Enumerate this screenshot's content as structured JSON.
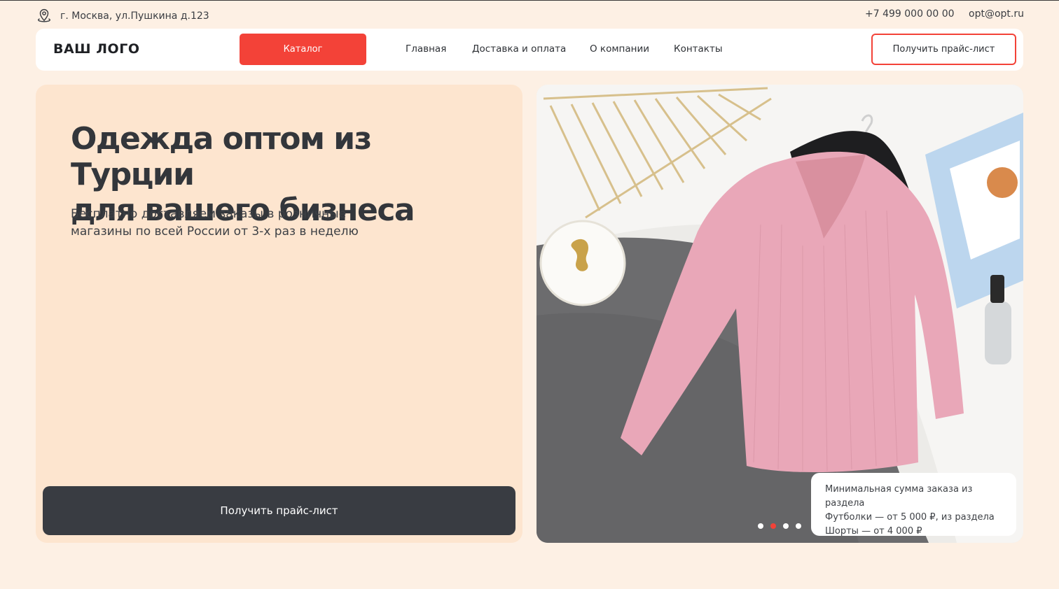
{
  "topbar": {
    "address": "г. Москва, ул.Пушкина д.123",
    "phone": "+7 499 000 00 00",
    "email": "opt@opt.ru",
    "address_icon": "location-pin-icon"
  },
  "nav": {
    "logo": "ВАШ ЛОГО",
    "catalog_label": "Каталог",
    "links": [
      "Главная",
      "Доставка и оплата",
      "О компании",
      "Контакты"
    ],
    "price_button": "Получить прайс-лист"
  },
  "hero": {
    "title_line1": "Одежда оптом из Турции",
    "title_line2": "для вашего бизнеса",
    "subtitle_line1": "Бесплатно доставляем заказы в розничные",
    "subtitle_line2": "магазины по всей России от 3-х раз в неделю",
    "cta_label": "Получить прайс-лист",
    "info_line1": "Минимальная сумма заказа из раздела",
    "info_line2": "Футболки — от 5 000 ₽, из раздела",
    "info_line3": "Шорты — от 4 000 ₽",
    "slider": {
      "total": 4,
      "active": 2
    }
  },
  "colors": {
    "accent": "#f34238",
    "background": "#fdf0e4",
    "card": "#fde5cf",
    "dark": "#393c42"
  }
}
